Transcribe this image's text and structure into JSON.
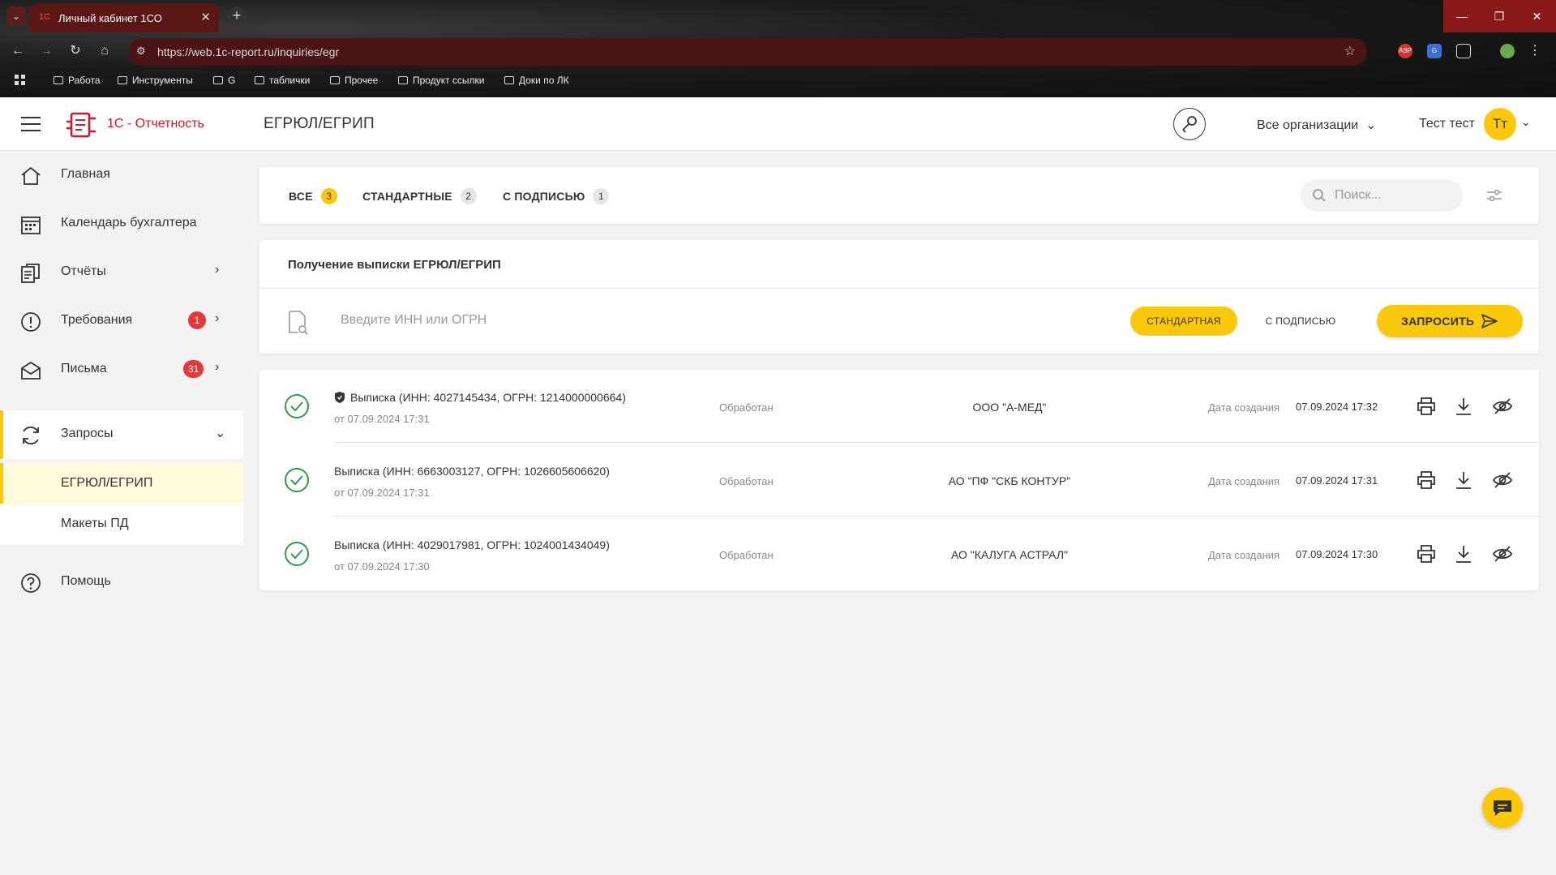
{
  "browser": {
    "tab_title": "Личный кабинет 1СО",
    "tab_favicon": "1С",
    "url": "https://web.1c-report.ru/inquiries/egr",
    "bookmarks": [
      "Работа",
      "Инструменты",
      "G",
      "таблички",
      "Прочее",
      "Продукт ссылки",
      "Доки по ЛК"
    ],
    "extensions": [
      "ABP"
    ]
  },
  "header": {
    "logo_text": "1С - Отчетность",
    "page_title": "ЕГРЮЛ/ЕГРИП",
    "org_selector": "Все организации",
    "user_name": "Тест тест",
    "avatar_initials": "Тт"
  },
  "sidebar": {
    "items": [
      {
        "label": "Главная",
        "icon": "home-icon"
      },
      {
        "label": "Календарь бухгалтера",
        "icon": "calendar-icon"
      },
      {
        "label": "Отчёты",
        "icon": "reports-icon"
      },
      {
        "label": "Требования",
        "icon": "alert-icon",
        "badge": "1"
      },
      {
        "label": "Письма",
        "icon": "mail-icon",
        "badge": "31"
      },
      {
        "label": "Запросы",
        "icon": "refresh-icon"
      },
      {
        "label": "Помощь",
        "icon": "help-icon"
      }
    ],
    "subitems": [
      {
        "label": "ЕГРЮЛ/ЕГРИП"
      },
      {
        "label": "Макеты ПД"
      }
    ]
  },
  "filters": {
    "tabs": [
      {
        "label": "ВСЕ",
        "count": "3"
      },
      {
        "label": "СТАНДАРТНЫЕ",
        "count": "2"
      },
      {
        "label": "С ПОДПИСЬЮ",
        "count": "1"
      }
    ],
    "search_placeholder": "Поиск..."
  },
  "request": {
    "title": "Получение выписки ЕГРЮЛ/ЕГРИП",
    "input_placeholder": "Введите ИНН или ОГРН",
    "type_standard": "СТАНДАРТНАЯ",
    "type_signed": "С ПОДПИСЬЮ",
    "submit_label": "ЗАПРОСИТЬ"
  },
  "results": [
    {
      "name": "Выписка (ИНН: 4027145434, ОГРН: 1214000000664)",
      "signed": true,
      "date": "от 07.09.2024 17:31",
      "status": "Обработан",
      "org": "ООО \"А-МЕД\"",
      "created_label": "Дата создания",
      "created": "07.09.2024 17:32"
    },
    {
      "name": "Выписка (ИНН: 6663003127, ОГРН: 1026605606620)",
      "signed": false,
      "date": "от 07.09.2024 17:31",
      "status": "Обработан",
      "org": "АО \"ПФ \"СКБ КОНТУР\"",
      "created_label": "Дата создания",
      "created": "07.09.2024 17:31"
    },
    {
      "name": "Выписка (ИНН: 4029017981, ОГРН: 1024001434049)",
      "signed": false,
      "date": "от 07.09.2024 17:30",
      "status": "Обработан",
      "org": "АО \"КАЛУГА АСТРАЛ\"",
      "created_label": "Дата создания",
      "created": "07.09.2024 17:30"
    }
  ],
  "colors": {
    "accent": "#fcc80a",
    "brand": "#d0192c",
    "badge": "#e5383b",
    "ok": "#2e9b4a"
  }
}
